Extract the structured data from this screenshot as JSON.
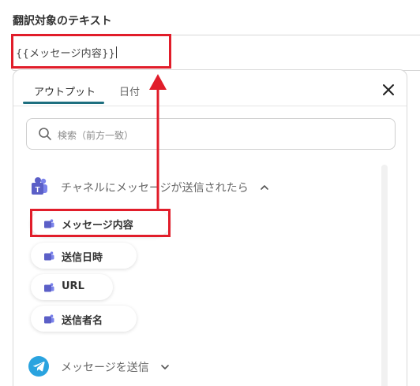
{
  "field": {
    "label": "翻訳対象のテキスト",
    "value": "{{メッセージ内容}}"
  },
  "panel": {
    "tabs": [
      {
        "label": "アウトプット",
        "active": true
      },
      {
        "label": "日付",
        "active": false
      }
    ],
    "search": {
      "placeholder": "検索（前方一致）"
    },
    "groups": [
      {
        "title": "チャネルにメッセージが送信されたら",
        "icon": "teams-icon",
        "expanded": true,
        "items": [
          {
            "label": "メッセージ内容",
            "highlighted": true
          },
          {
            "label": "送信日時",
            "highlighted": false
          },
          {
            "label": "URL",
            "highlighted": false
          },
          {
            "label": "送信者名",
            "highlighted": false
          }
        ]
      },
      {
        "title": "メッセージを送信",
        "icon": "telegram-icon",
        "expanded": false,
        "items": []
      }
    ]
  },
  "colors": {
    "accent": "#1e6f7f",
    "annotation": "#e11d2a",
    "teams": "#5b5fc7",
    "telegram": "#2aa3df"
  }
}
